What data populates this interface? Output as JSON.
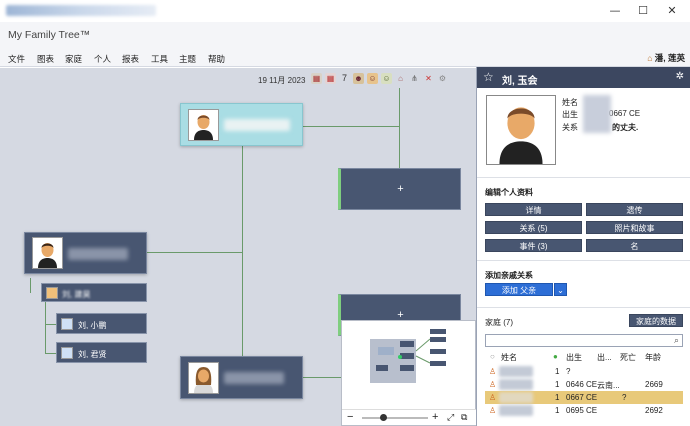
{
  "titlebar": {
    "minimize": "—",
    "maximize": "☐",
    "close": "✕"
  },
  "app": {
    "title": "My Family Tree™"
  },
  "menu": {
    "items": [
      "文件",
      "图表",
      "家庭",
      "个人",
      "报表",
      "工具",
      "主题",
      "帮助"
    ],
    "user": "潘, 莲英"
  },
  "toolbar": {
    "date": "19 11月 2023",
    "zoom": "7"
  },
  "tree": {
    "add_label": "+",
    "children": [
      {
        "name": "刘, 小鹏"
      },
      {
        "name": "刘, 君贤"
      }
    ],
    "partial_name": "刘, 建昊"
  },
  "minimap": {
    "minus": "−",
    "plus": "+"
  },
  "panel": {
    "title": "刘, 玉会",
    "settings_icon": "gear-icon",
    "labels": {
      "name": "姓名",
      "born": "出生",
      "relation": "关系"
    },
    "born_value": "0667 CE",
    "relation_value": "的丈夫.",
    "edit_title": "编辑个人资料",
    "edit_buttons": [
      "详情",
      "遗传",
      "关系 (5)",
      "照片和故事",
      "事件 (3)",
      "名"
    ],
    "add_rel_title": "添加亲戚关系",
    "add_rel_button": "添加 父亲",
    "family_title": "家庭 (7)",
    "family_data_button": "家庭的数据",
    "columns": {
      "name": "姓名",
      "born": "出生",
      "born2": "出...",
      "died": "死亡",
      "age": "年龄"
    },
    "rows": [
      {
        "num": "1",
        "born": "?",
        "place": "",
        "died": "",
        "age": ""
      },
      {
        "num": "1",
        "born": "0646 CE",
        "place": "云南...",
        "died": "",
        "age": "2669"
      },
      {
        "num": "1",
        "born": "0667 CE",
        "place": "",
        "died": "?",
        "age": ""
      },
      {
        "num": "1",
        "born": "0695 CE",
        "place": "",
        "died": "",
        "age": "2692"
      }
    ]
  },
  "colors": {
    "node": "#485671",
    "selected": "#a9dde4",
    "panel_header": "#3c4760",
    "highlight": "#e8c97a",
    "accent": "#2d6ed6"
  }
}
